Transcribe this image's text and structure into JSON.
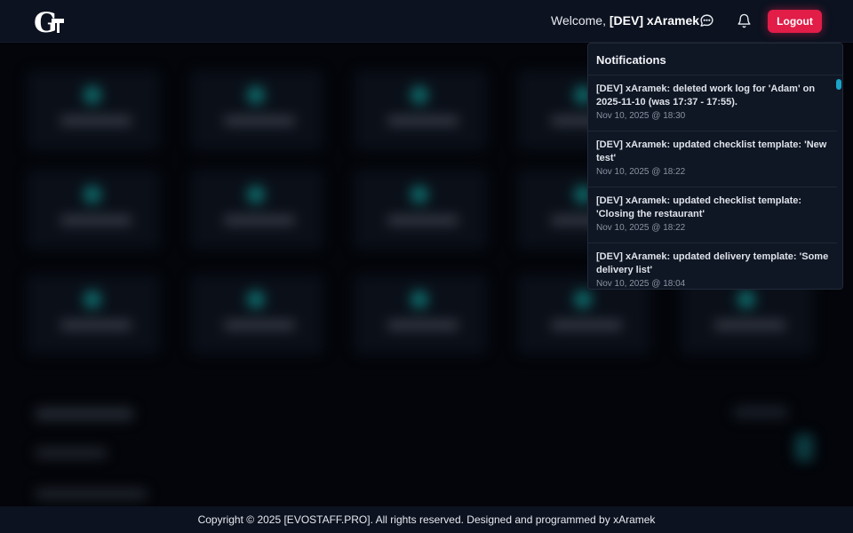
{
  "header": {
    "welcome_prefix": "Welcome, ",
    "username": "[DEV] xAramek",
    "logout_label": "Logout",
    "logo_letter": "G"
  },
  "notifications": {
    "title": "Notifications",
    "items": [
      {
        "message": "[DEV] xAramek: deleted work log for 'Adam' on 2025-11-10 (was 17:37 - 17:55).",
        "time": "Nov 10, 2025 @ 18:30"
      },
      {
        "message": "[DEV] xAramek: updated checklist template: 'New test'",
        "time": "Nov 10, 2025 @ 18:22"
      },
      {
        "message": "[DEV] xAramek: updated checklist template: 'Closing the restaurant'",
        "time": "Nov 10, 2025 @ 18:22"
      },
      {
        "message": "[DEV] xAramek: updated delivery template: 'Some delivery list'",
        "time": "Nov 10, 2025 @ 18:04"
      }
    ]
  },
  "footer": {
    "copyright": "Copyright © 2025 [EVOSTAFF.PRO]. All rights reserved. Designed and programmed by xAramek"
  },
  "colors": {
    "accent": "#e11d48",
    "scrollbar": "#1aa3c7",
    "header_bg": "#0c1220"
  },
  "icons": [
    "chat-bubble-icon",
    "bell-icon",
    "logo-icon"
  ]
}
